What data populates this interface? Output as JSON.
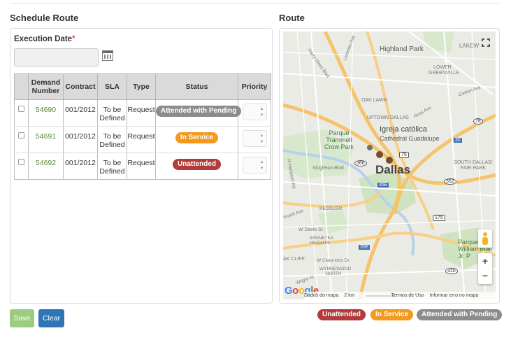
{
  "schedule": {
    "title": "Schedule Route",
    "execution_label": "Execution Date",
    "required_mark": "*",
    "date_value": ""
  },
  "table": {
    "headers": [
      "Demand Number",
      "Contract",
      "SLA",
      "Type",
      "Status",
      "Priority"
    ],
    "rows": [
      {
        "demand": "54690",
        "contract": "001/2012",
        "sla": "To be Defined",
        "type": "Request",
        "status": "Attended with Pending",
        "status_color": "#8c8c8c",
        "priority": ""
      },
      {
        "demand": "54691",
        "contract": "001/2012",
        "sla": "To be Defined",
        "type": "Request",
        "status": "In Service",
        "status_color": "#f39a1e",
        "priority": ""
      },
      {
        "demand": "54692",
        "contract": "001/2012",
        "sla": "To be Defined",
        "type": "Request",
        "status": "Unattended",
        "status_color": "#b23b3b",
        "priority": ""
      }
    ]
  },
  "buttons": {
    "save": "Save",
    "clear": "Clear"
  },
  "route": {
    "title": "Route",
    "map_labels": {
      "highland_park": "Highland Park",
      "lakewood": "LAKEW",
      "lower_greenville": "LOWER GREENVILLE",
      "oak_lawn": "OAK LAWN",
      "uptown": "UPTOWN DALLAS",
      "igreja": "Igreja católica",
      "cathedral": "Cathedral Guadalupe",
      "parque_trammell": "Parque Trammell Crow Park",
      "dallas": "Dallas",
      "singleton": "Singleton Blvd",
      "south_dallas": "SOUTH DALLAS/ FAIR PARK",
      "kessler": "KESSLER",
      "w_davis": "W Davis St",
      "winnetka": "WINNETKA HEIGHTS",
      "parque_william": "Parque William Blair Jr. P",
      "oak_cliff": "AK CLIFF",
      "wynnewood": "WYNNEWOOD NORTH",
      "w_clarendon": "W Clarendon Dr",
      "hwy_35e": "35E",
      "hwy_75": "75",
      "hwy_78": "78",
      "hwy_30": "30",
      "hwy_366": "366",
      "hwy_352": "352",
      "hwy_175": "175",
      "hwy_310": "310",
      "harry_hines": "Harry Hines Blvd",
      "lemmon": "Lemmon Ave",
      "gaston": "Gaston Ave",
      "ross": "Ross Ave",
      "worth": "Worth Ave",
      "n_hampton": "N Hampton Rd",
      "wright": "Wright St"
    },
    "footer": {
      "google": "Google",
      "map_data": "Dados do mapa",
      "scale": "2 km",
      "terms": "Termos de Uso",
      "report": "Informar erro no mapa"
    }
  },
  "legend": [
    {
      "label": "Unattended",
      "color": "#b23b3b"
    },
    {
      "label": "In Service",
      "color": "#f39a1e"
    },
    {
      "label": "Attended with Pending",
      "color": "#8c8c8c"
    }
  ]
}
